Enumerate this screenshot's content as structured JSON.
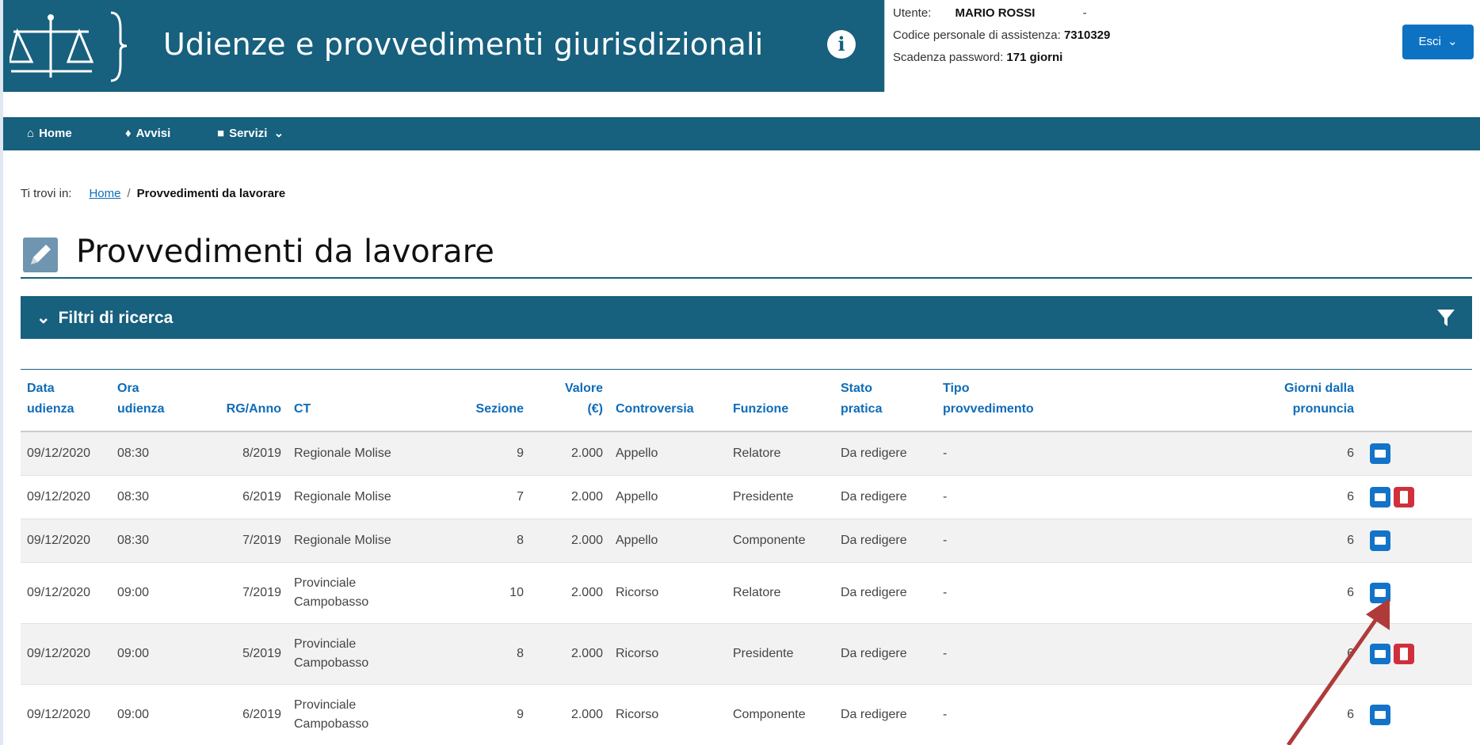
{
  "header": {
    "title": "Udienze e provvedimenti giurisdizionali",
    "user_label": "Utente:",
    "user_name": "MARIO ROSSI",
    "user_dash": "-",
    "code_label": "Codice personale di assistenza:",
    "code_value": "7310329",
    "pwd_label": "Scadenza password:",
    "pwd_value": "171 giorni",
    "logout_label": "Esci"
  },
  "nav": {
    "home": "Home",
    "avvisi": "Avvisi",
    "servizi": "Servizi"
  },
  "breadcrumb": {
    "prefix": "Ti trovi in:",
    "home": "Home",
    "separator": "/",
    "current": "Provvedimenti da lavorare"
  },
  "page_title": "Provvedimenti da lavorare",
  "filters": {
    "label": "Filtri di ricerca"
  },
  "table": {
    "headers": {
      "data_1": "Data",
      "data_2": "udienza",
      "ora_1": "Ora",
      "ora_2": "udienza",
      "rg": "RG/Anno",
      "ct": "CT",
      "sezione": "Sezione",
      "valore_1": "Valore",
      "valore_2": "(€)",
      "controversia": "Controversia",
      "funzione": "Funzione",
      "stato_1": "Stato",
      "stato_2": "pratica",
      "tipo_1": "Tipo",
      "tipo_2": "provvedimento",
      "giorni_1": "Giorni dalla",
      "giorni_2": "pronuncia"
    },
    "rows": [
      {
        "data": "09/12/2020",
        "ora": "08:30",
        "rg": "8/2019",
        "ct1": "Regionale Molise",
        "ct2": "",
        "sezione": "9",
        "valore": "2.000",
        "controversia": "Appello",
        "funzione": "Relatore",
        "stato": "Da redigere",
        "tipo": "-",
        "giorni": "6"
      },
      {
        "data": "09/12/2020",
        "ora": "08:30",
        "rg": "6/2019",
        "ct1": "Regionale Molise",
        "ct2": "",
        "sezione": "7",
        "valore": "2.000",
        "controversia": "Appello",
        "funzione": "Presidente",
        "stato": "Da redigere",
        "tipo": "-",
        "giorni": "6"
      },
      {
        "data": "09/12/2020",
        "ora": "08:30",
        "rg": "7/2019",
        "ct1": "Regionale Molise",
        "ct2": "",
        "sezione": "8",
        "valore": "2.000",
        "controversia": "Appello",
        "funzione": "Componente",
        "stato": "Da redigere",
        "tipo": "-",
        "giorni": "6"
      },
      {
        "data": "09/12/2020",
        "ora": "09:00",
        "rg": "7/2019",
        "ct1": "Provinciale",
        "ct2": "Campobasso",
        "sezione": "10",
        "valore": "2.000",
        "controversia": "Ricorso",
        "funzione": "Relatore",
        "stato": "Da redigere",
        "tipo": "-",
        "giorni": "6"
      },
      {
        "data": "09/12/2020",
        "ora": "09:00",
        "rg": "5/2019",
        "ct1": "Provinciale",
        "ct2": "Campobasso",
        "sezione": "8",
        "valore": "2.000",
        "controversia": "Ricorso",
        "funzione": "Presidente",
        "stato": "Da redigere",
        "tipo": "-",
        "giorni": "6"
      },
      {
        "data": "09/12/2020",
        "ora": "09:00",
        "rg": "6/2019",
        "ct1": "Provinciale",
        "ct2": "Campobasso",
        "sezione": "9",
        "valore": "2.000",
        "controversia": "Ricorso",
        "funzione": "Componente",
        "stato": "Da redigere",
        "tipo": "-",
        "giorni": "6"
      }
    ]
  },
  "colors": {
    "brand": "#17607e",
    "link": "#0e6cb8",
    "doc_button": "#1273c9",
    "pdf_button": "#d0303c",
    "arrow": "#b03a3a"
  },
  "icons": [
    "scales-logo-icon",
    "info-icon",
    "home-icon",
    "bell-icon",
    "briefcase-icon",
    "chevron-down-icon",
    "pencil-icon",
    "funnel-icon",
    "folder-icon",
    "pdf-icon"
  ]
}
